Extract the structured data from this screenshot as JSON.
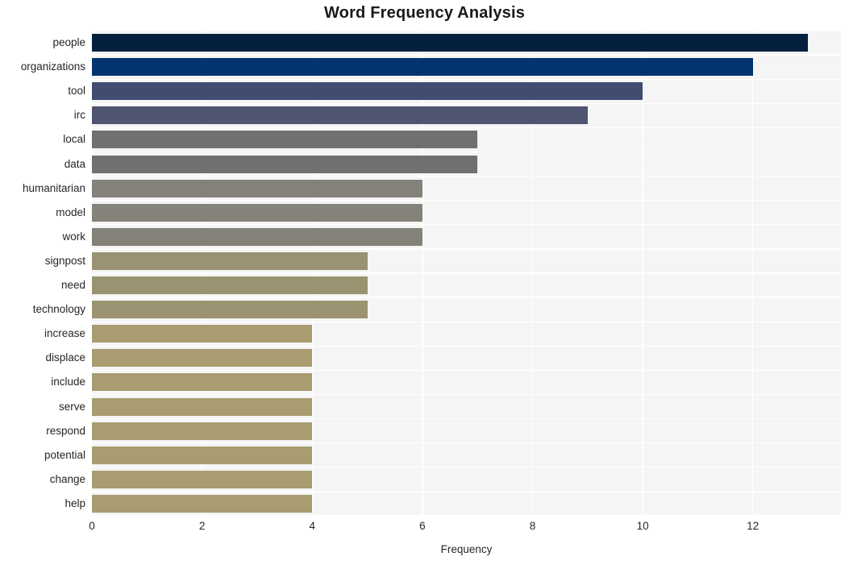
{
  "chart_data": {
    "type": "bar",
    "orientation": "horizontal",
    "title": "Word Frequency Analysis",
    "xlabel": "Frequency",
    "ylabel": "",
    "categories": [
      "people",
      "organizations",
      "tool",
      "irc",
      "local",
      "data",
      "humanitarian",
      "model",
      "work",
      "signpost",
      "need",
      "technology",
      "increase",
      "displace",
      "include",
      "serve",
      "respond",
      "potential",
      "change",
      "help"
    ],
    "values": [
      13,
      12,
      10,
      9,
      7,
      7,
      6,
      6,
      6,
      5,
      5,
      5,
      4,
      4,
      4,
      4,
      4,
      4,
      4,
      4
    ],
    "xlim": [
      0,
      13.6
    ],
    "xticks": [
      0,
      2,
      4,
      6,
      8,
      10,
      12
    ],
    "xticklabels": [
      "0",
      "2",
      "4",
      "6",
      "8",
      "10",
      "12"
    ],
    "grid": true,
    "grid_color": "#ffffff",
    "plot_background": "#f5f5f5",
    "figure_background": "#ffffff",
    "legend": null,
    "bar_colors": [
      "#04203f",
      "#043470",
      "#404c70",
      "#4f5470",
      "#70706f",
      "#717070",
      "#83817a",
      "#848279",
      "#848278",
      "#9a9272",
      "#9a9371",
      "#9b9371",
      "#a89c70",
      "#a89c70",
      "#a89c70",
      "#a89c70",
      "#a89c70",
      "#a89c70",
      "#a89c70",
      "#a89c70"
    ]
  }
}
